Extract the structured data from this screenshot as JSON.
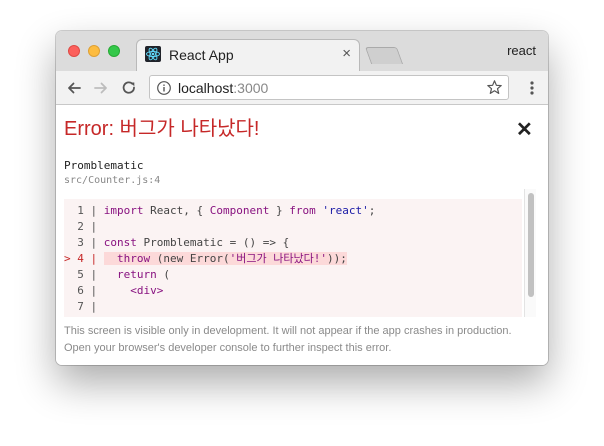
{
  "browser": {
    "tab_title": "React App",
    "tab_close": "×",
    "profile_name": "react",
    "url_host": "localhost",
    "url_port": ":3000",
    "icons": {
      "back": "arrow-left-icon",
      "forward": "arrow-right-icon",
      "reload": "reload-icon",
      "info": "info-icon",
      "bookmark": "star-icon",
      "menu": "kebab-menu-icon",
      "favicon": "react-logo-icon"
    }
  },
  "overlay": {
    "title": "Error: 버그가 나타났다!",
    "close_label": "✕",
    "frame_name": "Promblematic",
    "frame_file": "src/Counter.js:4",
    "footer_line1": "This screen is visible only in development. It will not appear if the app crashes in production.",
    "footer_line2": "Open your browser's developer console to further inspect this error.",
    "title_color": "#c62828"
  },
  "code": {
    "line1_gutter": "  1 | ",
    "line1_kw": "import",
    "line1_a": " React, { ",
    "line1_id": "Component",
    "line1_b": " } ",
    "line1_kw2": "from",
    "line1_sp": " ",
    "line1_str": "'react'",
    "line1_end": ";",
    "line2_gutter": "  2 | ",
    "line3_gutter": "  3 | ",
    "line3_kw": "const",
    "line3_a": " Promblematic = () => {",
    "line4_gutter": "> 4 | ",
    "line4_indent": "  ",
    "line4_kw": "throw",
    "line4_a": " (new Error(",
    "line4_str": "'버그가 나타났다!'",
    "line4_b": "));",
    "line5_gutter": "  5 | ",
    "line5_indent": "  ",
    "line5_kw": "return",
    "line5_a": " (",
    "line6_gutter": "  6 | ",
    "line6_indent": "    ",
    "line6_tag": "<div>",
    "line7_gutter": "  7 | "
  }
}
